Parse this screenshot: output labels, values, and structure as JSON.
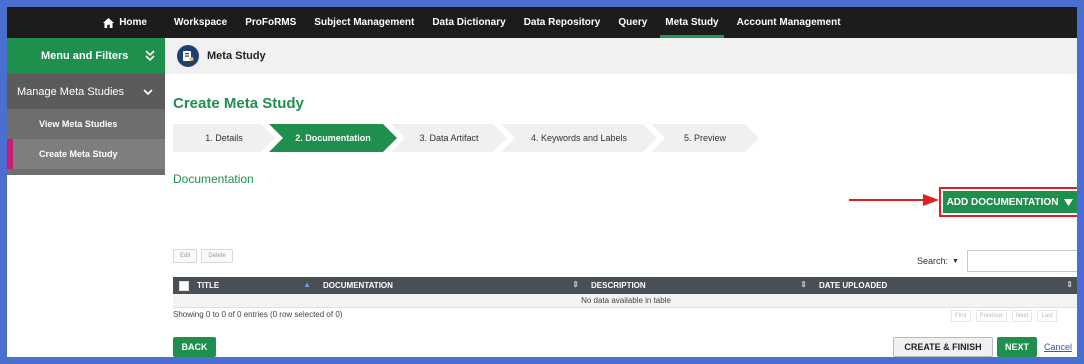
{
  "nav": {
    "home_label": "Home",
    "items": [
      {
        "label": "Workspace"
      },
      {
        "label": "ProFoRMS"
      },
      {
        "label": "Subject Management"
      },
      {
        "label": "Data Dictionary"
      },
      {
        "label": "Data Repository"
      },
      {
        "label": "Query"
      },
      {
        "label": "Meta Study",
        "active": true
      },
      {
        "label": "Account Management"
      }
    ]
  },
  "sidebar": {
    "header": "Menu and Filters",
    "section": "Manage Meta Studies",
    "items": [
      {
        "label": "View Meta Studies"
      },
      {
        "label": "Create Meta Study",
        "active": true
      }
    ]
  },
  "breadcrumb": {
    "title": "Meta Study"
  },
  "page": {
    "title": "Create Meta Study",
    "section_title": "Documentation"
  },
  "steps": [
    {
      "label": "1. Details"
    },
    {
      "label": "2. Documentation",
      "active": true
    },
    {
      "label": "3. Data Artifact"
    },
    {
      "label": "4. Keywords and Labels"
    },
    {
      "label": "5. Preview"
    }
  ],
  "toolbar": {
    "add_documentation": "ADD DOCUMENTATION",
    "edit": "Edit",
    "delete": "Delete"
  },
  "search": {
    "label": "Search:"
  },
  "table": {
    "columns": [
      "TITLE",
      "DOCUMENTATION",
      "DESCRIPTION",
      "DATE UPLOADED"
    ],
    "empty_message": "No data available in table",
    "showing": "Showing 0 to 0 of 0 entries (0 row selected of 0)"
  },
  "pager": {
    "first": "First",
    "previous": "Previous",
    "next": "Next",
    "last": "Last"
  },
  "footer": {
    "back": "BACK",
    "create_finish": "CREATE & FINISH",
    "next": "NEXT",
    "cancel": "Cancel"
  },
  "colors": {
    "accent": "#1f8f4d",
    "nav_bg": "#1c1c1c",
    "highlight": "#e02020",
    "sidebar_active": "#c81b7b"
  }
}
